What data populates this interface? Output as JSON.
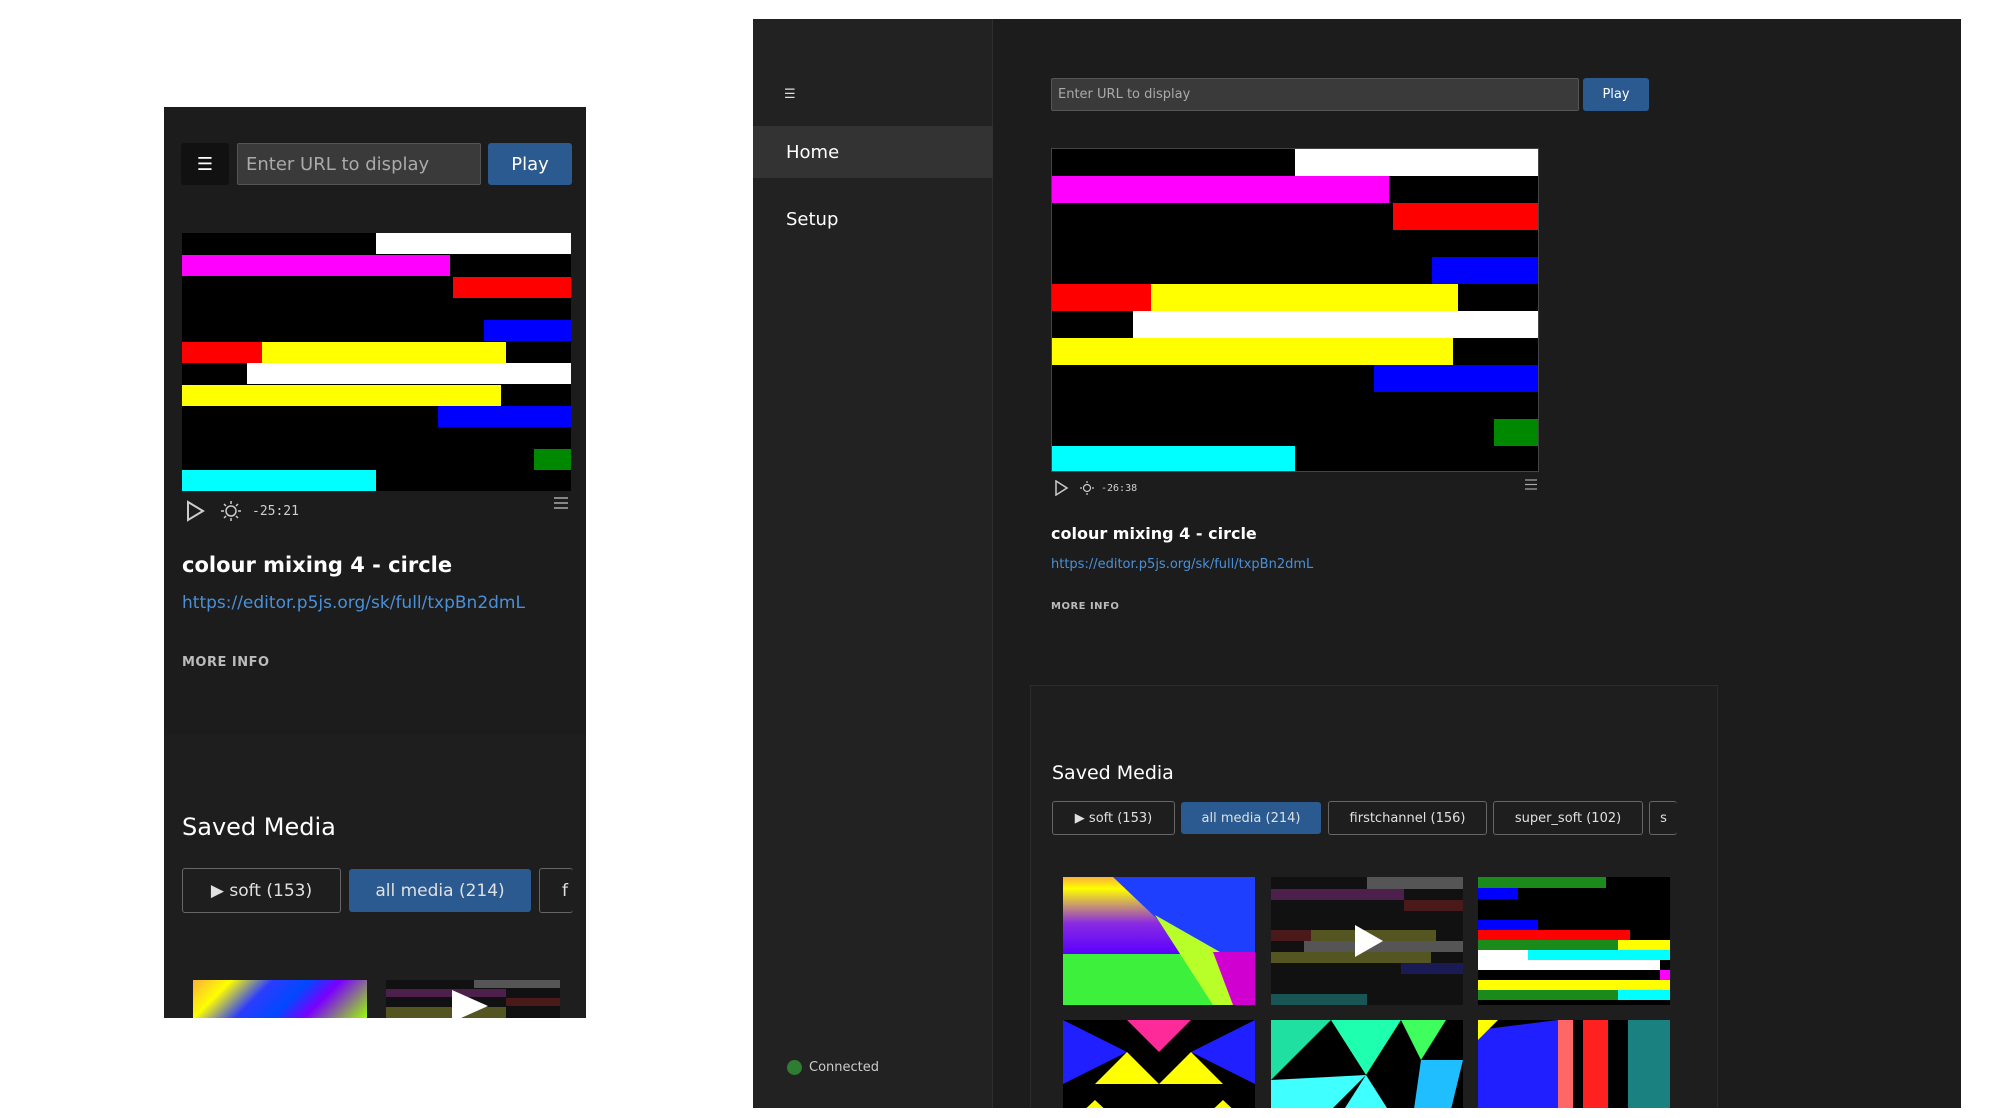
{
  "common": {
    "url_placeholder": "Enter URL to display",
    "play_label": "Play",
    "menu_icon": "☰",
    "media_title": "colour mixing 4 - circle",
    "media_url": "https://editor.p5js.org/sk/full/txpBn2dmL",
    "more_info": "MORE INFO",
    "saved_media_heading": "Saved Media"
  },
  "mobile": {
    "time": "-25:21",
    "chips": [
      "▶ soft (153)",
      "all media (214)",
      "f"
    ]
  },
  "desktop": {
    "time": "-26:38",
    "sidebar": {
      "items": [
        "Home",
        "Setup"
      ],
      "status": "Connected"
    },
    "chips": [
      "▶ soft (153)",
      "all media (214)",
      "firstchannel (156)",
      "super_soft (102)",
      "s"
    ]
  },
  "colors": {
    "bg": "#1c1c1c",
    "sidebar_bg": "#222222",
    "accent": "#2a5a8f",
    "link": "#4a90d9",
    "status_ok": "#2e7d32"
  },
  "icons": [
    "menu-icon",
    "play-icon",
    "brightness-icon",
    "list-icon",
    "status-dot-icon"
  ]
}
